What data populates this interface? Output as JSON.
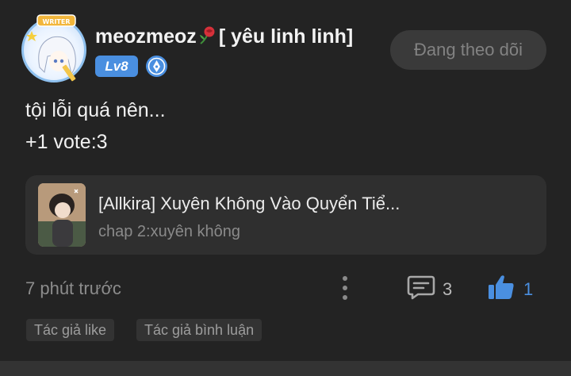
{
  "post": {
    "author": {
      "name_part1": "meozmeoz",
      "name_part2": "[ yêu linh linh]",
      "avatar_badge_text": "WRITER",
      "level": "Lv8"
    },
    "follow_label": "Đang theo dõi",
    "content_lines": [
      "tội lỗi quá nên...",
      "+1 vote:3"
    ],
    "story": {
      "title": "[Allkira] Xuyên Không Vào Quyển Tiể...",
      "chapter": "chap 2:xuyên không"
    },
    "timestamp": "7 phút trước",
    "comment_count": "3",
    "like_count": "1",
    "tags": [
      "Tác giả like",
      "Tác giả bình luận"
    ]
  },
  "icons": {
    "rose": "rose-emoji-icon",
    "writer": "pen-nib-icon",
    "more": "more-vertical-icon",
    "comment": "comment-icon",
    "like": "thumbs-up-icon"
  },
  "colors": {
    "background": "#232323",
    "accent": "#4a8fe0",
    "card": "#2f2f2f",
    "button_bg": "#3a3a3a",
    "muted_text": "#8c8c8c"
  }
}
